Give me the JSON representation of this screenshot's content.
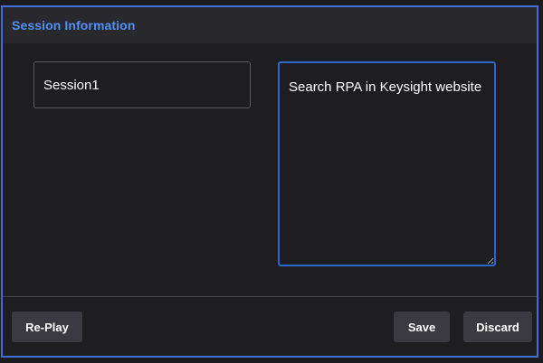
{
  "dialog": {
    "title": "Session Information"
  },
  "form": {
    "session_name_value": "Session1",
    "description_value": "Search RPA in Keysight website"
  },
  "footer": {
    "replay_label": "Re-Play",
    "save_label": "Save",
    "discard_label": "Discard"
  },
  "colors": {
    "accent": "#4f8ff7",
    "focus_border": "#2e66c9",
    "dialog_border": "#3d6fd6",
    "button_bg": "#3a3a40"
  }
}
